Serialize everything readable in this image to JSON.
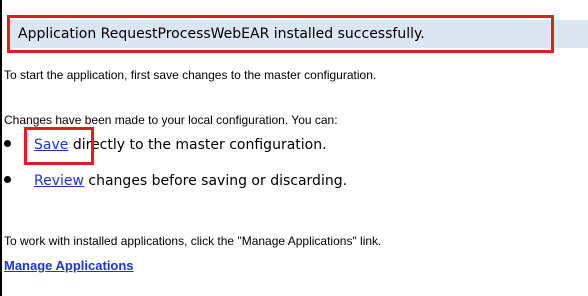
{
  "message_banner": {
    "text": "Application RequestProcessWebEAR installed successfully."
  },
  "instructions": {
    "start_text": "To start the application, first save changes to the master configuration.",
    "changes_text": "Changes have been made to your local configuration. You can:",
    "manage_text": "To work with installed applications, click the \"Manage Applications\" link."
  },
  "options": [
    {
      "link": "Save",
      "rest": " directly to the master configuration."
    },
    {
      "link": "Review",
      "rest": " changes before saving or discarding."
    }
  ],
  "manage_link": "Manage Applications",
  "colors": {
    "link": "#1b36cc",
    "banner_background": "#dce5f2",
    "highlight": "#e31b23"
  }
}
